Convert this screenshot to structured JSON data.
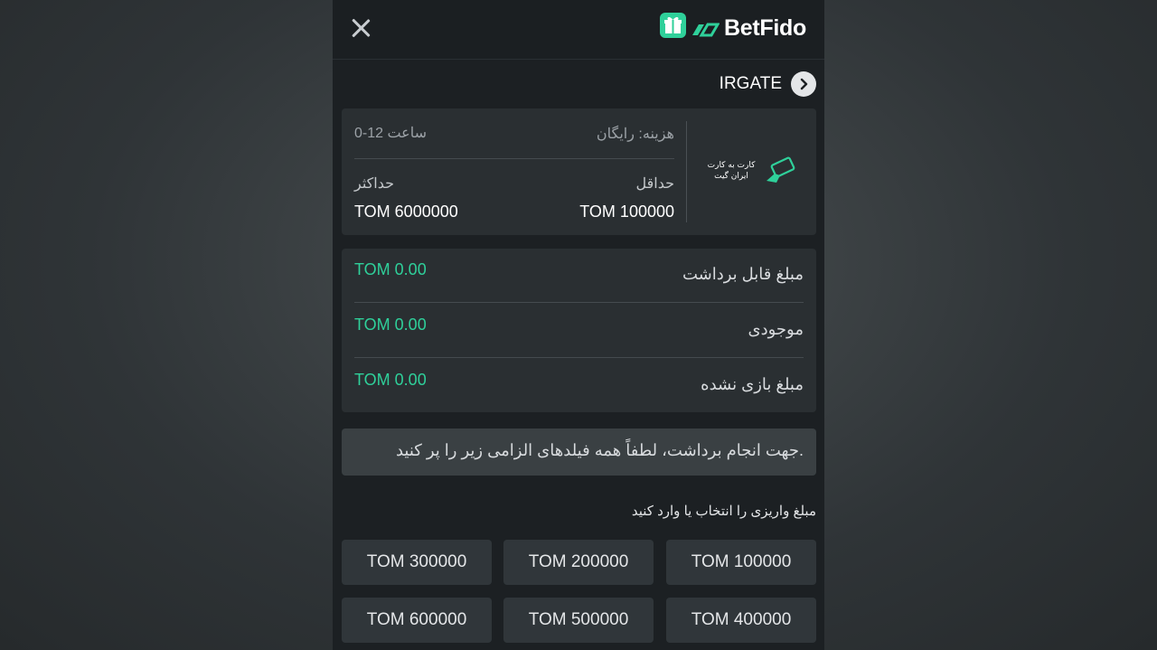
{
  "header": {
    "brand": "BetFido",
    "accent": "#2fd09a"
  },
  "provider": {
    "name": "IRGATE"
  },
  "method": {
    "logo_text_line1": "کارت به کارت",
    "logo_text_line2": "ایران گیت",
    "fee": "هزینه: رایگان",
    "time": "0-12 ساعت",
    "min_label": "حداقل",
    "min_value": "TOM 100000",
    "max_label": "حداکثر",
    "max_value": "TOM 6000000"
  },
  "balances": [
    {
      "label": "مبلغ قابل برداشت",
      "value": "TOM 0.00"
    },
    {
      "label": "موجودی",
      "value": "TOM 0.00"
    },
    {
      "label": "مبلغ بازی نشده",
      "value": "TOM 0.00"
    }
  ],
  "notice": "جهت انجام برداشت، لطفاً همه فیلدهای الزامی زیر را پر کنید.",
  "amount_section_label": "مبلغ واریزی را انتخاب یا وارد کنید",
  "amounts": [
    "TOM 100000",
    "TOM 200000",
    "TOM 300000",
    "TOM 400000",
    "TOM 500000",
    "TOM 600000"
  ]
}
